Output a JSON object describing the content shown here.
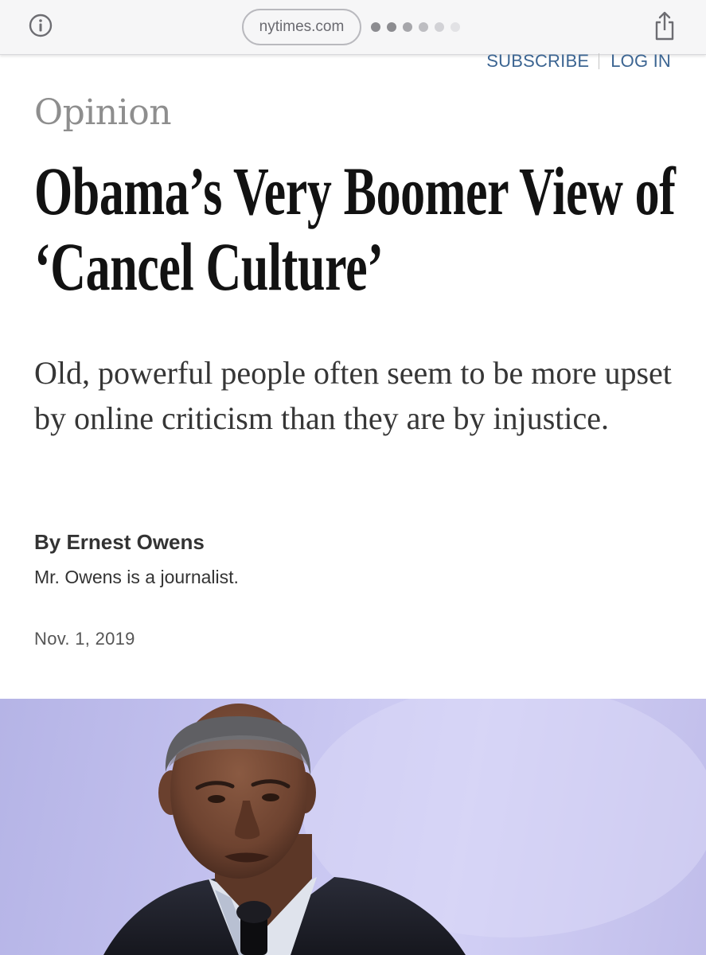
{
  "browser": {
    "url_domain": "nytimes.com",
    "info_icon": "info-circle-icon",
    "share_icon": "share-icon",
    "loading_dot_colors": [
      "#8c8c90",
      "#8c8c90",
      "#a6a6aa",
      "#bdbdc1",
      "#d2d2d6",
      "#e2e2e5"
    ]
  },
  "header": {
    "subscribe_label": "SUBSCRIBE",
    "login_label": "LOG IN",
    "link_color": "#3c6592"
  },
  "article": {
    "section": "Opinion",
    "headline": "Obama’s Very Boomer View of ‘Cancel Culture’",
    "summary": "Old, powerful people often seem to be more upset by online criticism than they are by injustice.",
    "byline": "By Ernest Owens",
    "author_bio": "Mr. Owens is a journalist.",
    "date": "Nov. 1, 2019"
  },
  "lead_image": {
    "subject": "portrait photo of Barack Obama speaking into a microphone",
    "background_color": "#c4c2ef"
  }
}
